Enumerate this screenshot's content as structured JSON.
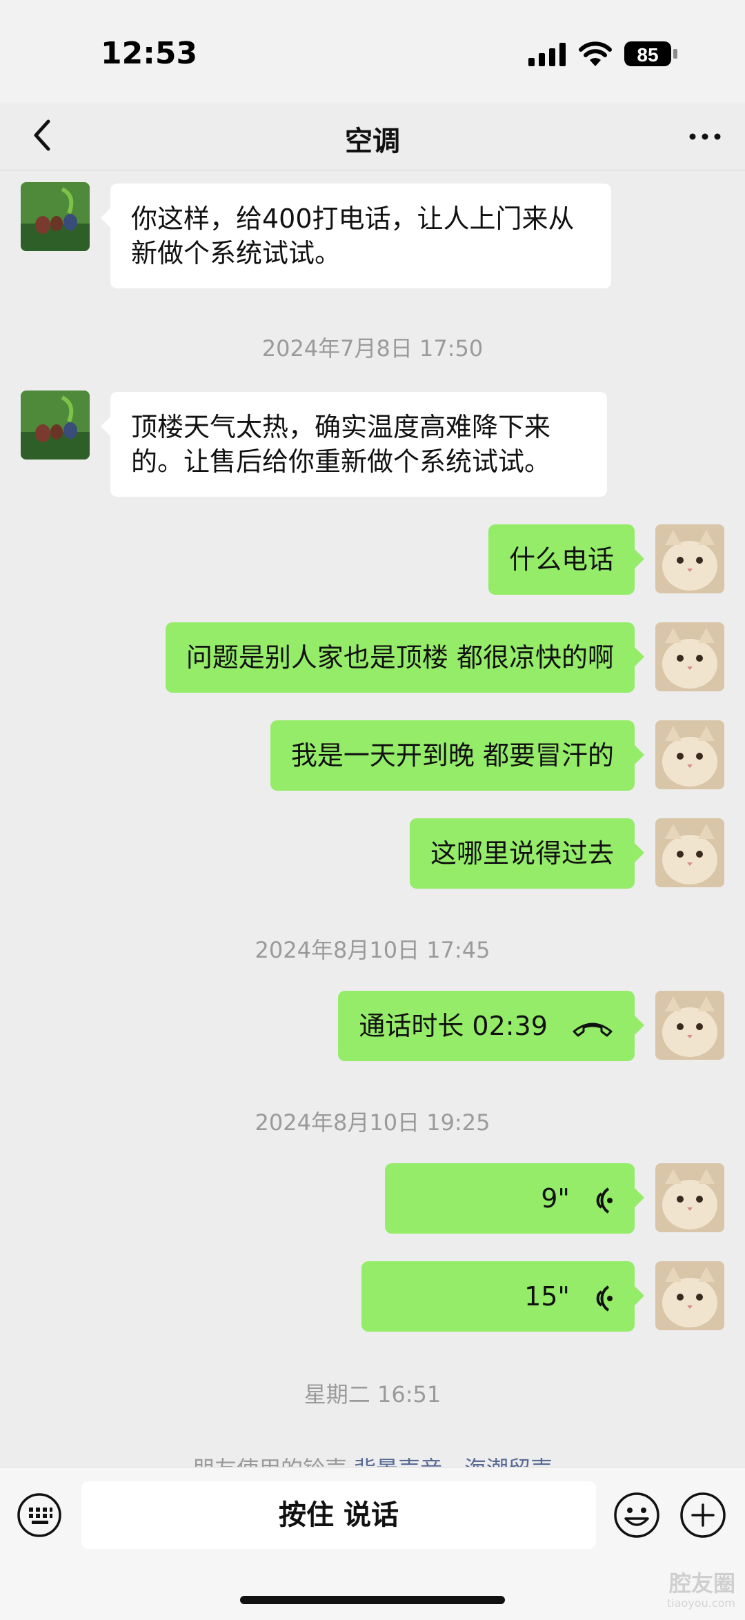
{
  "status_bar": {
    "time": "12:53",
    "battery": "85"
  },
  "nav": {
    "title": "空调"
  },
  "messages": {
    "m1": {
      "text": "你这样，给400打电话，让人上门来从新做个系统试试。"
    },
    "ts1": "2024年7月8日 17:50",
    "m2": {
      "text": "顶楼天气太热，确实温度高难降下来的。让售后给你重新做个系统试试。"
    },
    "m3": {
      "text": "什么电话"
    },
    "m4": {
      "text": "问题是别人家也是顶楼 都很凉快的啊"
    },
    "m5": {
      "text": "我是一天开到晚 都要冒汗的"
    },
    "m6": {
      "text": "这哪里说得过去"
    },
    "ts2": "2024年8月10日 17:45",
    "m7": {
      "text": "通话时长 02:39"
    },
    "ts3": "2024年8月10日 19:25",
    "m8": {
      "duration": "9\""
    },
    "m9": {
      "duration": "15\""
    },
    "ts4": "星期二 16:51",
    "note": {
      "prefix": "朋友使用的铃声",
      "link1": "背景声音",
      "sep": " - ",
      "link2": "海潮留声"
    }
  },
  "input": {
    "talk_label": "按住 说话"
  },
  "watermark": {
    "text": "腔友圈",
    "sub": "tiaoyou.com"
  },
  "colors": {
    "self_bubble": "#95ec69",
    "other_bubble": "#ffffff",
    "background": "#ededed",
    "link": "#576b95"
  }
}
